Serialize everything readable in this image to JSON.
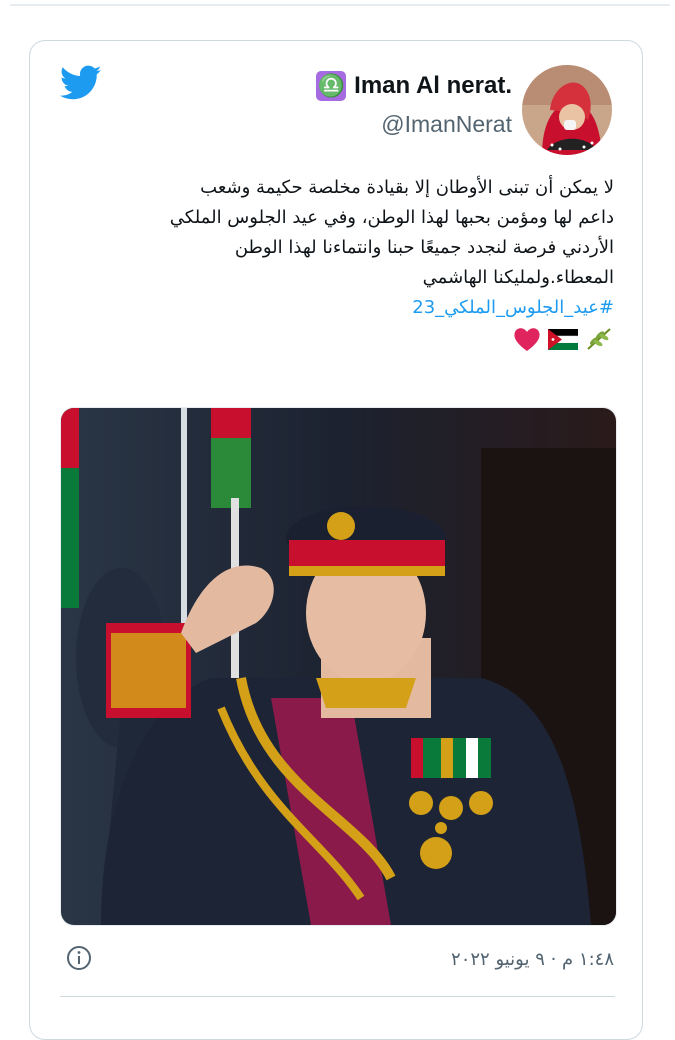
{
  "tweet": {
    "display_name": "Iman Al nerat.",
    "zodiac_badge": "♎",
    "handle": "@ImanNerat",
    "text_lines": [
      "لا يمكن أن تبنى الأوطان إلا بقيادة مخلصة حكيمة وشعب",
      "داعم لها ومؤمن بحبها لهذا الوطن، وفي عيد الجلوس الملكي",
      "الأردني فرصة لنجدد جميعًا حبنا وانتماءنا لهذا الوطن",
      "المعطاء.ولمليكنا الهاشمي"
    ],
    "hashtag": "#عيد_الجلوس_الملكي_23",
    "emojis": [
      "olive-branch",
      "jordan-flag",
      "red-heart"
    ],
    "timestamp": "١:٤٨ م · ٩ يونيو ٢٠٢٢"
  },
  "icons": {
    "brand": "twitter-bird-icon",
    "info": "info-icon"
  },
  "colors": {
    "twitter_blue": "#1d9bf0",
    "text": "#0f1419",
    "secondary": "#536471",
    "badge_purple": "#a66be0",
    "heart_red": "#e0245e"
  }
}
